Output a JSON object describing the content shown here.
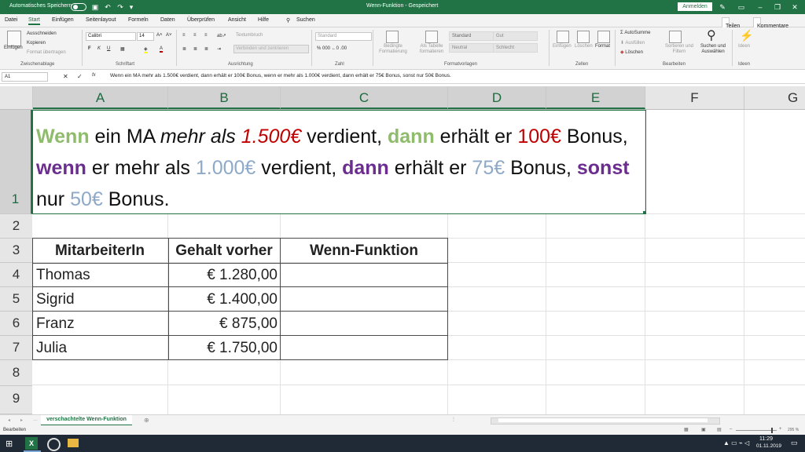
{
  "titlebar": {
    "autosave_label": "Automatisches Speichern",
    "doc_title": "Wenn-Funktion  -  Gespeichert",
    "signin": "Anmelden",
    "icons": [
      "save-icon",
      "undo-icon",
      "redo-icon",
      "customize-icon",
      "pen-icon",
      "ribbon-display-icon",
      "minimize-icon",
      "restore-icon",
      "close-icon"
    ]
  },
  "tabs": {
    "items": [
      "Datei",
      "Start",
      "Einfügen",
      "Seitenlayout",
      "Formeln",
      "Daten",
      "Überprüfen",
      "Ansicht",
      "Hilfe"
    ],
    "active": "Start",
    "search": "Suchen",
    "share": "Teilen",
    "comments": "Kommentare"
  },
  "ribbon": {
    "clipboard": {
      "paste": "Einfügen",
      "cut": "Ausschneiden",
      "copy": "Kopieren",
      "painter": "Format übertragen",
      "group": "Zwischenablage"
    },
    "font": {
      "name": "Calibri",
      "size": "14",
      "group": "Schriftart",
      "bold": "F",
      "italic": "K",
      "underline": "U"
    },
    "alignment": {
      "wrap": "Textumbruch",
      "merge": "Verbinden und zentrieren",
      "group": "Ausrichtung"
    },
    "number": {
      "format": "Standard",
      "group": "Zahl"
    },
    "styles": {
      "cond": "Bedingte Formatierung",
      "table": "Als Tabelle formatieren",
      "cells": [
        "Standard",
        "Gut",
        "Neutral",
        "Schlecht"
      ],
      "group": "Formatvorlagen"
    },
    "cells": {
      "insert": "Einfügen",
      "delete": "Löschen",
      "format": "Format",
      "group": "Zellen"
    },
    "editing": {
      "autosum": "AutoSumme",
      "fill": "Ausfüllen",
      "clear": "Löschen",
      "sort": "Sortieren und Filtern",
      "find": "Suchen und Auswählen",
      "group": "Bearbeiten"
    },
    "ideas": {
      "label": "Ideen",
      "group": "Ideen"
    }
  },
  "formula_bar": {
    "name_box": "A1",
    "fx": "fx",
    "content": "Wenn ein MA mehr als 1.500€ verdient, dann erhält er 100€ Bonus, wenn er mehr als 1.000€ verdient, dann erhält er 75€ Bonus, sonst nur 50€ Bonus."
  },
  "columns": [
    "A",
    "B",
    "C",
    "D",
    "E",
    "F",
    "G"
  ],
  "rows": [
    "1",
    "2",
    "3",
    "4",
    "5",
    "6",
    "7",
    "8",
    "9"
  ],
  "a1_runs": [
    {
      "text": "Wenn",
      "color": "#8fbc6a",
      "bold": true
    },
    {
      "text": " ein MA ",
      "color": "#111111"
    },
    {
      "text": "mehr als",
      "color": "#111111",
      "italic": true
    },
    {
      "text": " ",
      "color": "#111111"
    },
    {
      "text": "1.500€",
      "color": "#c00000",
      "italic": true
    },
    {
      "text": " verdient, ",
      "color": "#111111"
    },
    {
      "text": "dann",
      "color": "#8fbc6a",
      "bold": true
    },
    {
      "text": " erhält er ",
      "color": "#111111"
    },
    {
      "text": "100€",
      "color": "#c00000"
    },
    {
      "text": " Bonus, ",
      "color": "#111111"
    },
    {
      "text": "wenn",
      "color": "#6b2d8f",
      "bold": true
    },
    {
      "text": " er mehr als ",
      "color": "#111111"
    },
    {
      "text": "1.000€",
      "color": "#8ea9c8"
    },
    {
      "text": " verdient, ",
      "color": "#111111"
    },
    {
      "text": "dann",
      "color": "#6b2d8f",
      "bold": true
    },
    {
      "text": " erhält er ",
      "color": "#111111"
    },
    {
      "text": "75€",
      "color": "#8ea9c8"
    },
    {
      "text": " Bonus, ",
      "color": "#111111"
    },
    {
      "text": "sonst",
      "color": "#6b2d8f",
      "bold": true
    },
    {
      "text": " nur ",
      "color": "#111111"
    },
    {
      "text": "50€",
      "color": "#8ea9c8"
    },
    {
      "text": " Bonus.",
      "color": "#111111"
    }
  ],
  "table": {
    "headers": [
      "MitarbeiterIn",
      "Gehalt vorher",
      "Wenn-Funktion"
    ],
    "rows": [
      {
        "name": "Thomas",
        "salary": "€ 1.280,00",
        "result": ""
      },
      {
        "name": "Sigrid",
        "salary": "€ 1.400,00",
        "result": ""
      },
      {
        "name": "Franz",
        "salary": "€ 875,00",
        "result": ""
      },
      {
        "name": "Julia",
        "salary": "€ 1.750,00",
        "result": ""
      }
    ]
  },
  "sheet_tab": "verschachtelte Wenn-Funktion",
  "status": {
    "mode": "Bearbeiten",
    "zoom": "295 %"
  },
  "taskbar": {
    "time": "11:29",
    "date": "01.11.2019"
  },
  "colors": {
    "excel_green": "#217346",
    "taskbar": "#1f2a36"
  }
}
